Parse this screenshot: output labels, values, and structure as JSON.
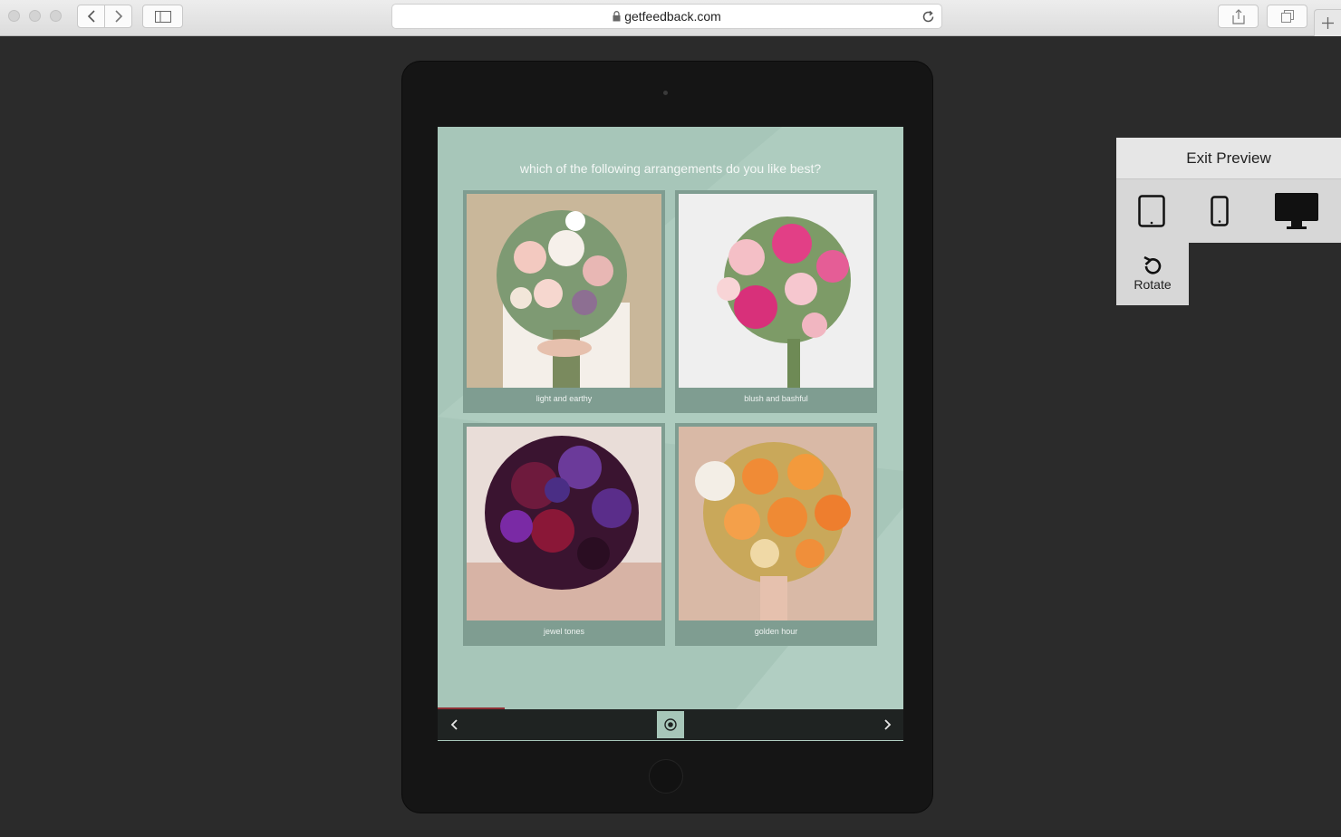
{
  "browser": {
    "url": "getfeedback.com",
    "icons": {
      "back": "chevron-left-icon",
      "forward": "chevron-right-icon",
      "sidebar": "sidebar-icon",
      "lock": "lock-icon",
      "reload": "reload-icon",
      "share": "share-icon",
      "tabs": "tabs-icon",
      "new_tab": "plus-icon"
    }
  },
  "survey": {
    "question": "which of the following arrangements do you like best?",
    "options": [
      {
        "caption": "light and earthy"
      },
      {
        "caption": "blush and bashful"
      },
      {
        "caption": "jewel tones"
      },
      {
        "caption": "golden hour"
      }
    ],
    "colors": {
      "background": "#a7c6b9",
      "card": "#7f9d91",
      "navbar": "#1f2322",
      "progress": "#8e2f34"
    }
  },
  "preview_panel": {
    "exit_label": "Exit Preview",
    "devices": [
      "tablet-icon",
      "phone-icon",
      "desktop-icon"
    ],
    "rotate_label": "Rotate"
  }
}
